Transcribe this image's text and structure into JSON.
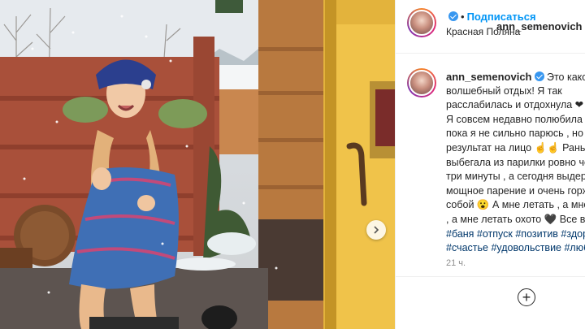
{
  "header": {
    "username": "ann_semenovich",
    "separator": "•",
    "follow_label": "Подписаться",
    "location": "Красная Поляна"
  },
  "caption": {
    "username": "ann_semenovich",
    "lines": [
      "Это какой-то",
      "волшебный отдых! Я так",
      "расслабилась и отдохнула ❤",
      "Я совсем недавно полюбила баню,",
      "пока я не сильно парюсь , но",
      "результат на лицо ☝☝ Раньше",
      "выбегала из парилки ровно через",
      "три минуты , а сегодня выдержала",
      "мощное парение и очень горжусь",
      "собой 😮 А мне летать , а мне",
      ", а мне летать охото 🖤 Все в баню!"
    ],
    "hashtags_line1": "#баня #отпуск #позитив #здоровье",
    "hashtags_line2": "#счастье #удовольствие #любовь",
    "time": "21 ч."
  },
  "icons": {
    "verified": "verified-badge-icon",
    "next": "chevron-right-icon",
    "add": "plus-circle-icon"
  },
  "colors": {
    "link": "#0095f6",
    "hashtag": "#00376b",
    "verified": "#3897f0",
    "muted": "#8e8e8e"
  }
}
